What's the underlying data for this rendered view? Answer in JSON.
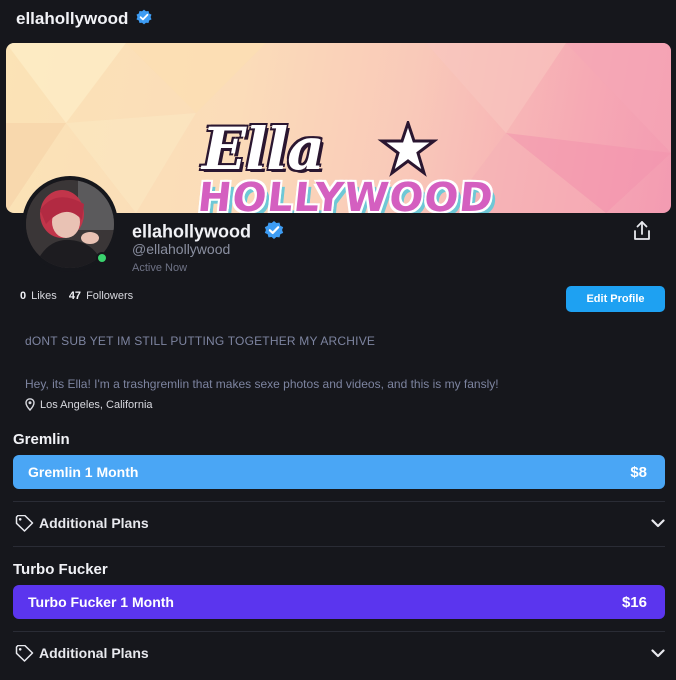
{
  "header": {
    "title": "ellahollywood"
  },
  "banner": {
    "logo_top": "Ella",
    "logo_bottom": "HOLLYWOOD"
  },
  "profile": {
    "display_name": "ellahollywood",
    "handle": "@ellahollywood",
    "status": "Active Now",
    "likes_count": "0",
    "likes_label": "Likes",
    "followers_count": "47",
    "followers_label": "Followers",
    "edit_button": "Edit Profile"
  },
  "bio": {
    "line1": "dONT SUB YET IM STILL PUTTING TOGETHER MY ARCHIVE",
    "line2": "Hey, its Ella! I'm a trashgremlin that makes sexe photos and videos, and this is my fansly!",
    "location": "Los Angeles, California"
  },
  "tiers": [
    {
      "name": "Gremlin",
      "plan_label": "Gremlin 1 Month",
      "price": "$8",
      "color": "#4aa6f5",
      "additional": "Additional Plans"
    },
    {
      "name": "Turbo Fucker",
      "plan_label": "Turbo Fucker 1 Month",
      "price": "$16",
      "color": "#5b35ee",
      "additional": "Additional Plans"
    }
  ],
  "icons": {
    "verified": "verified-badge-icon",
    "share": "share-icon",
    "location": "location-pin-icon",
    "tag": "tag-icon",
    "chevron": "chevron-down-icon"
  }
}
